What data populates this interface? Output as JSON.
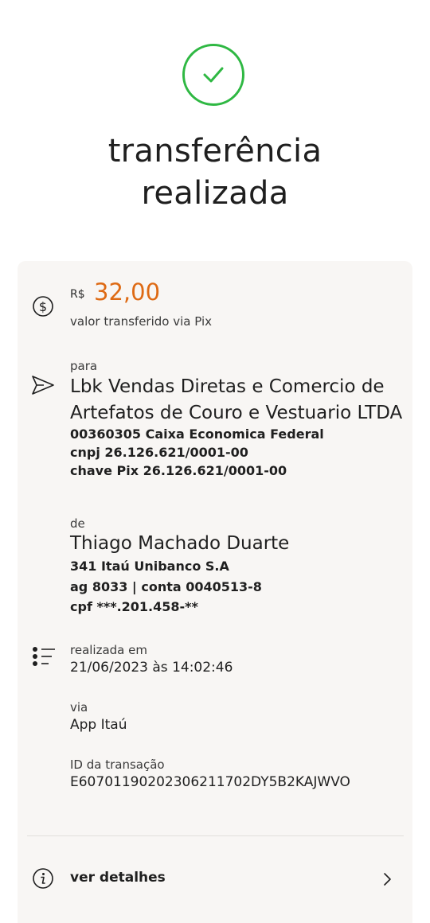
{
  "header": {
    "icon": "check-circle-icon",
    "accent_color": "#2fb843",
    "title_line1": "transferência",
    "title_line2": "realizada"
  },
  "amount": {
    "icon": "dollar-circle-icon",
    "currency": "R$",
    "value": "32,00",
    "value_color": "#de6a14",
    "caption": "valor transferido via Pix"
  },
  "recipient": {
    "icon": "send-icon",
    "label": "para",
    "name_line1": "Lbk Vendas Diretas e Comercio de",
    "name_line2": "Artefatos de Couro e Vestuario LTDA",
    "bank": "00360305 Caixa Economica Federal",
    "cnpj": "cnpj 26.126.621/0001-00",
    "pix_key": "chave Pix 26.126.621/0001-00"
  },
  "sender": {
    "label": "de",
    "name": "Thiago Machado Duarte",
    "bank": "341 Itaú Unibanco S.A",
    "account": "ag 8033 | conta 0040513-8",
    "cpf": "cpf ***.201.458-**"
  },
  "details": {
    "icon": "list-icon",
    "date_label": "realizada em",
    "date_value": "21/06/2023 às 14:02:46",
    "via_label": "via",
    "via_value": "App Itaú",
    "id_label": "ID da transação",
    "id_value": "E60701190202306211702DY5B2KAJWVO"
  },
  "footer": {
    "info_icon": "info-icon",
    "details_label": "ver detalhes",
    "chevron_icon": "chevron-right-icon"
  }
}
